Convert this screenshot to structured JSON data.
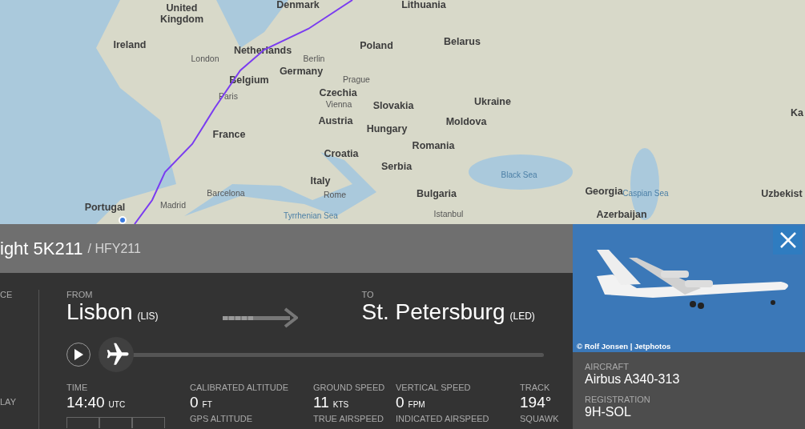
{
  "map": {
    "labels": [
      {
        "text": "United",
        "kind": "country"
      },
      {
        "text": "Kingdom",
        "kind": "country"
      },
      {
        "text": "Ireland",
        "kind": "country"
      },
      {
        "text": "London",
        "kind": "city"
      },
      {
        "text": "Denmark",
        "kind": "country"
      },
      {
        "text": "Lithuania",
        "kind": "country"
      },
      {
        "text": "Netherlands",
        "kind": "country"
      },
      {
        "text": "Berlin",
        "kind": "city"
      },
      {
        "text": "Poland",
        "kind": "country"
      },
      {
        "text": "Belarus",
        "kind": "country"
      },
      {
        "text": "Germany",
        "kind": "country"
      },
      {
        "text": "Belgium",
        "kind": "country"
      },
      {
        "text": "Prague",
        "kind": "city"
      },
      {
        "text": "Paris",
        "kind": "city"
      },
      {
        "text": "Czechia",
        "kind": "country"
      },
      {
        "text": "Vienna",
        "kind": "city"
      },
      {
        "text": "Slovakia",
        "kind": "country"
      },
      {
        "text": "Ukraine",
        "kind": "country"
      },
      {
        "text": "Austria",
        "kind": "country"
      },
      {
        "text": "Hungary",
        "kind": "country"
      },
      {
        "text": "Moldova",
        "kind": "country"
      },
      {
        "text": "Ka",
        "kind": "country"
      },
      {
        "text": "France",
        "kind": "country"
      },
      {
        "text": "Croatia",
        "kind": "country"
      },
      {
        "text": "Romania",
        "kind": "country"
      },
      {
        "text": "Serbia",
        "kind": "country"
      },
      {
        "text": "Black Sea",
        "kind": "sea"
      },
      {
        "text": "Italy",
        "kind": "country"
      },
      {
        "text": "Bulgaria",
        "kind": "country"
      },
      {
        "text": "Georgia",
        "kind": "country"
      },
      {
        "text": "Caspian Sea",
        "kind": "sea"
      },
      {
        "text": "Uzbekist",
        "kind": "country"
      },
      {
        "text": "Portugal",
        "kind": "country"
      },
      {
        "text": "Madrid",
        "kind": "city"
      },
      {
        "text": "Barcelona",
        "kind": "city"
      },
      {
        "text": "Rome",
        "kind": "city"
      },
      {
        "text": "Tyrrhenian Sea",
        "kind": "sea"
      },
      {
        "text": "Istanbul",
        "kind": "city"
      },
      {
        "text": "Azerbaijan",
        "kind": "country"
      }
    ]
  },
  "flight": {
    "title": "ight 5K211",
    "subtitle": "/ HFY211"
  },
  "side_labels": [
    "CE",
    "LAY"
  ],
  "route": {
    "from_label": "FROM",
    "from_city": "Lisbon",
    "from_code": "(LIS)",
    "to_label": "TO",
    "to_city": "St. Petersburg",
    "to_code": "(LED)"
  },
  "progress": {
    "level": 0
  },
  "stats": [
    {
      "label": "TIME",
      "value": "14:40",
      "unit": "UTC"
    },
    {
      "label": "CALIBRATED ALTITUDE",
      "value": "0",
      "unit": "FT",
      "label2": "GPS ALTITUDE"
    },
    {
      "label": "GROUND SPEED",
      "value": "11",
      "unit": "KTS",
      "label2": "TRUE AIRSPEED"
    },
    {
      "label": "VERTICAL SPEED",
      "value": "0",
      "unit": "FPM",
      "label2": "INDICATED AIRSPEED"
    },
    {
      "label": "TRACK",
      "value": "194°",
      "label2": "SQUAWK"
    }
  ],
  "photo": {
    "credit": "© Rolf Jonsen | Jetphotos"
  },
  "aircraft": [
    {
      "label": "AIRCRAFT",
      "value": "Airbus A340-313"
    },
    {
      "label": "REGISTRATION",
      "value": "9H-SOL"
    }
  ]
}
